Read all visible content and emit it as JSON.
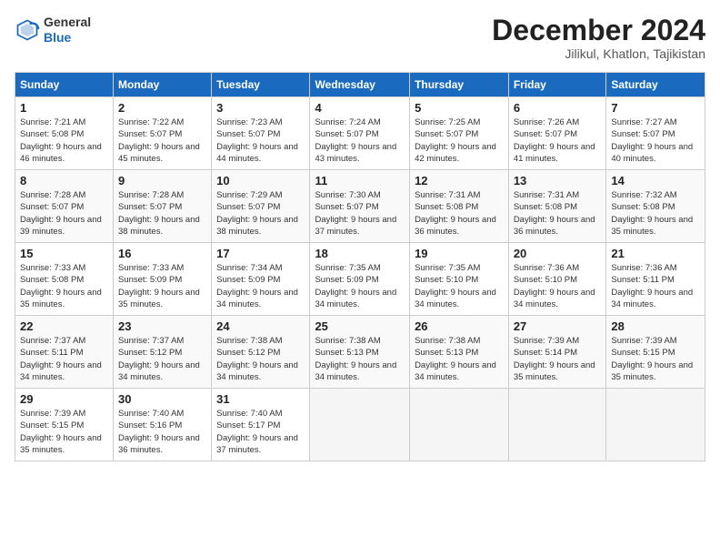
{
  "header": {
    "logo_general": "General",
    "logo_blue": "Blue",
    "month_title": "December 2024",
    "location": "Jilikul, Khatlon, Tajikistan"
  },
  "weekdays": [
    "Sunday",
    "Monday",
    "Tuesday",
    "Wednesday",
    "Thursday",
    "Friday",
    "Saturday"
  ],
  "weeks": [
    [
      {
        "day": "1",
        "sunrise": "Sunrise: 7:21 AM",
        "sunset": "Sunset: 5:08 PM",
        "daylight": "Daylight: 9 hours and 46 minutes."
      },
      {
        "day": "2",
        "sunrise": "Sunrise: 7:22 AM",
        "sunset": "Sunset: 5:07 PM",
        "daylight": "Daylight: 9 hours and 45 minutes."
      },
      {
        "day": "3",
        "sunrise": "Sunrise: 7:23 AM",
        "sunset": "Sunset: 5:07 PM",
        "daylight": "Daylight: 9 hours and 44 minutes."
      },
      {
        "day": "4",
        "sunrise": "Sunrise: 7:24 AM",
        "sunset": "Sunset: 5:07 PM",
        "daylight": "Daylight: 9 hours and 43 minutes."
      },
      {
        "day": "5",
        "sunrise": "Sunrise: 7:25 AM",
        "sunset": "Sunset: 5:07 PM",
        "daylight": "Daylight: 9 hours and 42 minutes."
      },
      {
        "day": "6",
        "sunrise": "Sunrise: 7:26 AM",
        "sunset": "Sunset: 5:07 PM",
        "daylight": "Daylight: 9 hours and 41 minutes."
      },
      {
        "day": "7",
        "sunrise": "Sunrise: 7:27 AM",
        "sunset": "Sunset: 5:07 PM",
        "daylight": "Daylight: 9 hours and 40 minutes."
      }
    ],
    [
      {
        "day": "8",
        "sunrise": "Sunrise: 7:28 AM",
        "sunset": "Sunset: 5:07 PM",
        "daylight": "Daylight: 9 hours and 39 minutes."
      },
      {
        "day": "9",
        "sunrise": "Sunrise: 7:28 AM",
        "sunset": "Sunset: 5:07 PM",
        "daylight": "Daylight: 9 hours and 38 minutes."
      },
      {
        "day": "10",
        "sunrise": "Sunrise: 7:29 AM",
        "sunset": "Sunset: 5:07 PM",
        "daylight": "Daylight: 9 hours and 38 minutes."
      },
      {
        "day": "11",
        "sunrise": "Sunrise: 7:30 AM",
        "sunset": "Sunset: 5:07 PM",
        "daylight": "Daylight: 9 hours and 37 minutes."
      },
      {
        "day": "12",
        "sunrise": "Sunrise: 7:31 AM",
        "sunset": "Sunset: 5:08 PM",
        "daylight": "Daylight: 9 hours and 36 minutes."
      },
      {
        "day": "13",
        "sunrise": "Sunrise: 7:31 AM",
        "sunset": "Sunset: 5:08 PM",
        "daylight": "Daylight: 9 hours and 36 minutes."
      },
      {
        "day": "14",
        "sunrise": "Sunrise: 7:32 AM",
        "sunset": "Sunset: 5:08 PM",
        "daylight": "Daylight: 9 hours and 35 minutes."
      }
    ],
    [
      {
        "day": "15",
        "sunrise": "Sunrise: 7:33 AM",
        "sunset": "Sunset: 5:08 PM",
        "daylight": "Daylight: 9 hours and 35 minutes."
      },
      {
        "day": "16",
        "sunrise": "Sunrise: 7:33 AM",
        "sunset": "Sunset: 5:09 PM",
        "daylight": "Daylight: 9 hours and 35 minutes."
      },
      {
        "day": "17",
        "sunrise": "Sunrise: 7:34 AM",
        "sunset": "Sunset: 5:09 PM",
        "daylight": "Daylight: 9 hours and 34 minutes."
      },
      {
        "day": "18",
        "sunrise": "Sunrise: 7:35 AM",
        "sunset": "Sunset: 5:09 PM",
        "daylight": "Daylight: 9 hours and 34 minutes."
      },
      {
        "day": "19",
        "sunrise": "Sunrise: 7:35 AM",
        "sunset": "Sunset: 5:10 PM",
        "daylight": "Daylight: 9 hours and 34 minutes."
      },
      {
        "day": "20",
        "sunrise": "Sunrise: 7:36 AM",
        "sunset": "Sunset: 5:10 PM",
        "daylight": "Daylight: 9 hours and 34 minutes."
      },
      {
        "day": "21",
        "sunrise": "Sunrise: 7:36 AM",
        "sunset": "Sunset: 5:11 PM",
        "daylight": "Daylight: 9 hours and 34 minutes."
      }
    ],
    [
      {
        "day": "22",
        "sunrise": "Sunrise: 7:37 AM",
        "sunset": "Sunset: 5:11 PM",
        "daylight": "Daylight: 9 hours and 34 minutes."
      },
      {
        "day": "23",
        "sunrise": "Sunrise: 7:37 AM",
        "sunset": "Sunset: 5:12 PM",
        "daylight": "Daylight: 9 hours and 34 minutes."
      },
      {
        "day": "24",
        "sunrise": "Sunrise: 7:38 AM",
        "sunset": "Sunset: 5:12 PM",
        "daylight": "Daylight: 9 hours and 34 minutes."
      },
      {
        "day": "25",
        "sunrise": "Sunrise: 7:38 AM",
        "sunset": "Sunset: 5:13 PM",
        "daylight": "Daylight: 9 hours and 34 minutes."
      },
      {
        "day": "26",
        "sunrise": "Sunrise: 7:38 AM",
        "sunset": "Sunset: 5:13 PM",
        "daylight": "Daylight: 9 hours and 34 minutes."
      },
      {
        "day": "27",
        "sunrise": "Sunrise: 7:39 AM",
        "sunset": "Sunset: 5:14 PM",
        "daylight": "Daylight: 9 hours and 35 minutes."
      },
      {
        "day": "28",
        "sunrise": "Sunrise: 7:39 AM",
        "sunset": "Sunset: 5:15 PM",
        "daylight": "Daylight: 9 hours and 35 minutes."
      }
    ],
    [
      {
        "day": "29",
        "sunrise": "Sunrise: 7:39 AM",
        "sunset": "Sunset: 5:15 PM",
        "daylight": "Daylight: 9 hours and 35 minutes."
      },
      {
        "day": "30",
        "sunrise": "Sunrise: 7:40 AM",
        "sunset": "Sunset: 5:16 PM",
        "daylight": "Daylight: 9 hours and 36 minutes."
      },
      {
        "day": "31",
        "sunrise": "Sunrise: 7:40 AM",
        "sunset": "Sunset: 5:17 PM",
        "daylight": "Daylight: 9 hours and 37 minutes."
      },
      null,
      null,
      null,
      null
    ]
  ]
}
